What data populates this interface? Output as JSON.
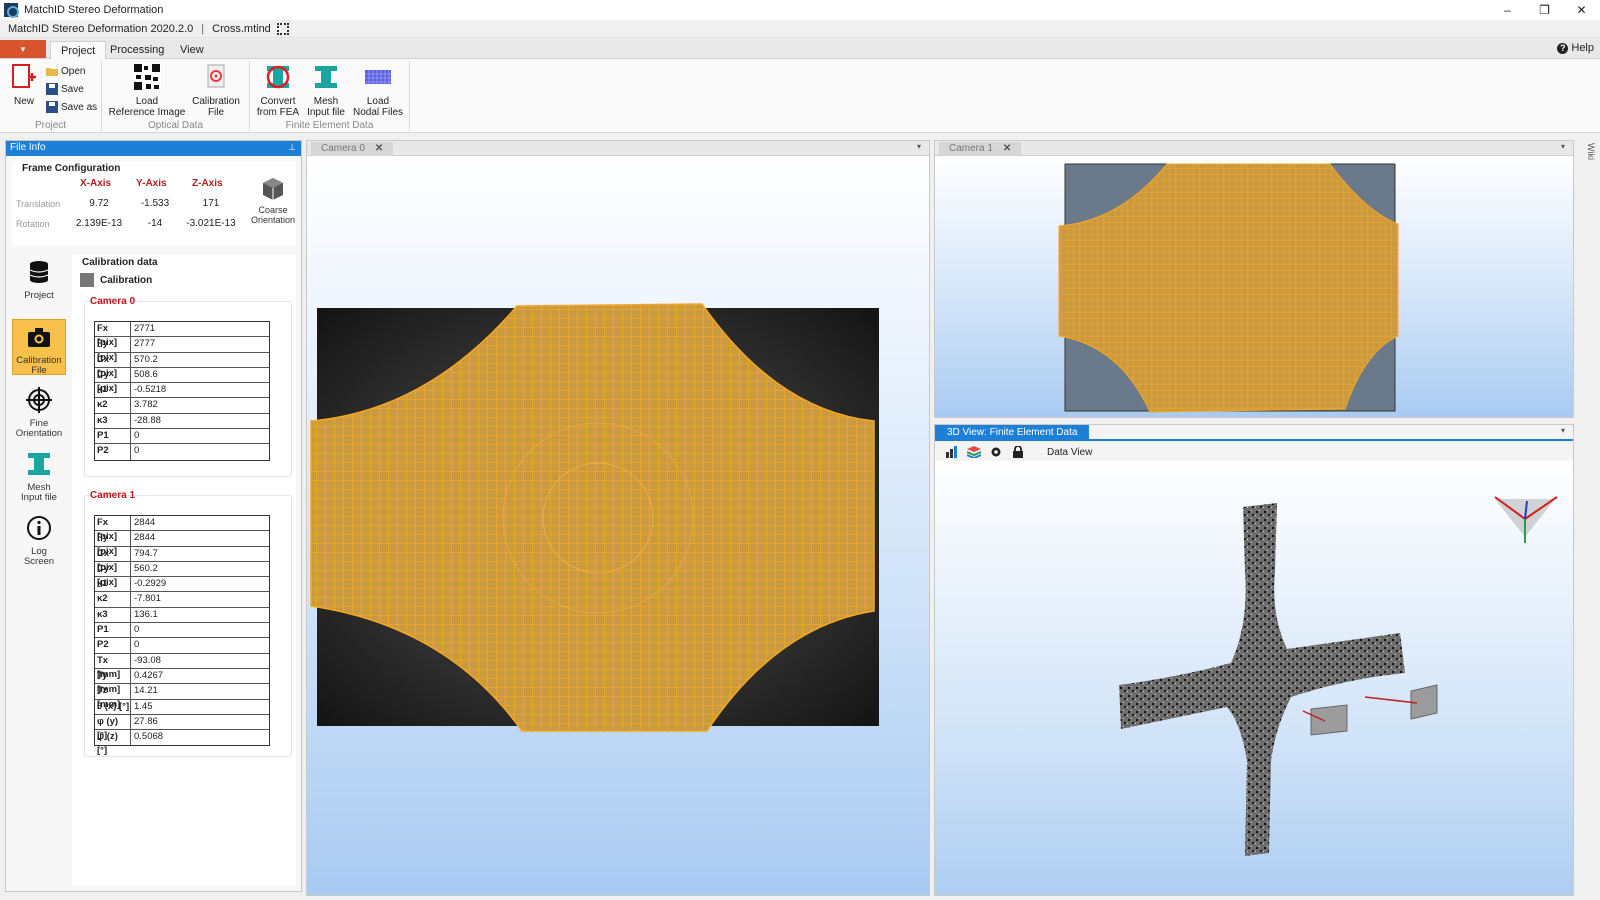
{
  "window": {
    "title": "MatchID Stereo Deformation",
    "minimize": "–",
    "maximize": "❐",
    "close": "✕"
  },
  "docbar": {
    "app_version": "MatchID Stereo Deformation 2020.2.0",
    "separator": "|",
    "file": "Cross.mtind"
  },
  "ribbon_tabs": {
    "file_menu": "▾",
    "tabs": [
      "Project",
      "Processing",
      "View"
    ],
    "active": "Project",
    "help": "Help"
  },
  "ribbon": {
    "project": {
      "new": "New",
      "open": "Open",
      "save": "Save",
      "save_as": "Save as",
      "group": "Project"
    },
    "optical": {
      "load_ref_line1": "Load",
      "load_ref_line2": "Reference Image",
      "calib_line1": "Calibration",
      "calib_line2": "File",
      "group": "Optical Data"
    },
    "fea": {
      "convert_line1": "Convert",
      "convert_line2": "from FEA",
      "mesh_line1": "Mesh",
      "mesh_line2": "Input file",
      "nodal_line1": "Load",
      "nodal_line2": "Nodal Files",
      "group": "Finite Element Data"
    }
  },
  "file_info": {
    "header": "File Info",
    "pin": "⊥",
    "frame_config": {
      "title": "Frame Configuration",
      "axes": [
        "X-Axis",
        "Y-Axis",
        "Z-Axis"
      ],
      "translation_label": "Translation",
      "translation": [
        "9.72",
        "-1.533",
        "171"
      ],
      "rotation_label": "Rotation",
      "rotation": [
        "2.139E-13",
        "-14",
        "-3.021E-13"
      ],
      "coarse_line1": "Coarse",
      "coarse_line2": "Orientation"
    },
    "nav": [
      {
        "l1": "Project",
        "l2": ""
      },
      {
        "l1": "Calibration",
        "l2": "File"
      },
      {
        "l1": "Fine",
        "l2": "Orientation"
      },
      {
        "l1": "Mesh",
        "l2": "Input file"
      },
      {
        "l1": "Log",
        "l2": "Screen"
      }
    ],
    "calibration": {
      "title": "Calibration data",
      "sub": "Calibration",
      "camera0": {
        "label": "Camera 0",
        "params": [
          {
            "k": "Fx [pix]",
            "v": "2771"
          },
          {
            "k": "Fy [pix]",
            "v": "2777"
          },
          {
            "k": "Cx [pix]",
            "v": "570.2"
          },
          {
            "k": "Cy [pix]",
            "v": "508.6"
          },
          {
            "k": "κ1",
            "v": "-0.5218"
          },
          {
            "k": "κ2",
            "v": "3.782"
          },
          {
            "k": "κ3",
            "v": "-28.88"
          },
          {
            "k": "P1",
            "v": "0"
          },
          {
            "k": "P2",
            "v": "0"
          }
        ]
      },
      "camera1": {
        "label": "Camera 1",
        "params": [
          {
            "k": "Fx [pix]",
            "v": "2844"
          },
          {
            "k": "Fy [pix]",
            "v": "2844"
          },
          {
            "k": "Cx [pix]",
            "v": "794.7"
          },
          {
            "k": "Cy [pix]",
            "v": "560.2"
          },
          {
            "k": "κ1",
            "v": "-0.2929"
          },
          {
            "k": "κ2",
            "v": "-7.801"
          },
          {
            "k": "κ3",
            "v": "136.1"
          },
          {
            "k": "P1",
            "v": "0"
          },
          {
            "k": "P2",
            "v": "0"
          },
          {
            "k": "Tx [mm]",
            "v": "-93.08"
          },
          {
            "k": "Ty [mm]",
            "v": "0.4267"
          },
          {
            "k": "Tz [mm]",
            "v": "14.21"
          },
          {
            "k": "θ (x) [°]",
            "v": "1.45"
          },
          {
            "k": "φ (y) [°]",
            "v": "27.86"
          },
          {
            "k": "ψ (z) [°]",
            "v": "0.5068"
          }
        ]
      }
    }
  },
  "camera0_tab": {
    "label": "Camera 0",
    "close": "✕",
    "dropdown": "▾"
  },
  "camera1_tab": {
    "label": "Camera 1",
    "close": "✕",
    "dropdown": "▾"
  },
  "view3d": {
    "label": "3D View: Finite Element Data",
    "data_view": "Data View",
    "dropdown": "▾"
  },
  "wiki": "Wiki",
  "colors": {
    "accent": "#1e7fd6",
    "mesh": "#f0a020",
    "active_nav": "#f6c04a",
    "camera_label": "#c0141c"
  }
}
